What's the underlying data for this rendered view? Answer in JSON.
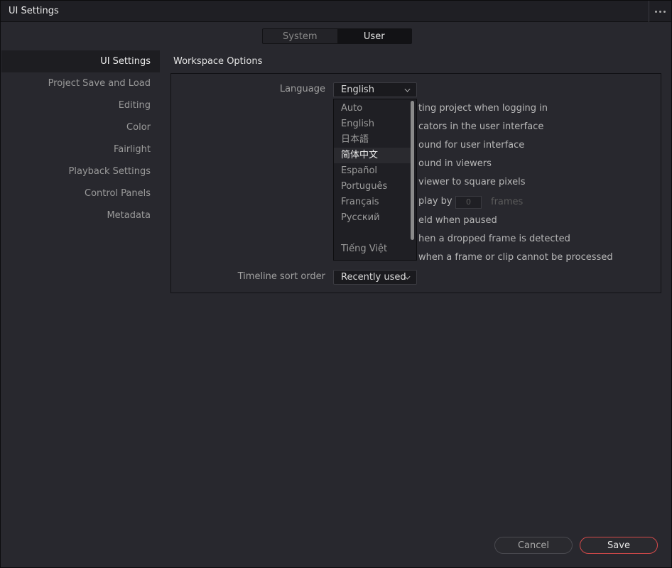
{
  "window": {
    "title": "UI Settings"
  },
  "tabs": [
    {
      "label": "System",
      "active": false
    },
    {
      "label": "User",
      "active": true
    }
  ],
  "sidebar": {
    "items": [
      {
        "label": "UI Settings",
        "active": true
      },
      {
        "label": "Project Save and Load",
        "active": false
      },
      {
        "label": "Editing",
        "active": false
      },
      {
        "label": "Color",
        "active": false
      },
      {
        "label": "Fairlight",
        "active": false
      },
      {
        "label": "Playback Settings",
        "active": false
      },
      {
        "label": "Control Panels",
        "active": false
      },
      {
        "label": "Metadata",
        "active": false
      }
    ]
  },
  "workspace": {
    "title": "Workspace Options",
    "language_label": "Language",
    "language_value": "English",
    "options": [
      "ting project when logging in",
      "cators in the user interface",
      "ound for user interface",
      "ound in viewers",
      "viewer to square pixels",
      "play by",
      "eld when paused",
      "hen a dropped frame is detected",
      "when a frame or clip cannot be processed"
    ],
    "delay_value": "0",
    "delay_unit": "frames",
    "timeline_label": "Timeline sort order",
    "timeline_value": "Recently used"
  },
  "language_dropdown": {
    "options": [
      "Auto",
      "English",
      "日本語",
      "简体中文",
      "Español",
      "Português",
      "Français",
      "Русский",
      "",
      "Tiếng Việt"
    ],
    "highlighted": "简体中文"
  },
  "footer": {
    "cancel_label": "Cancel",
    "save_label": "Save"
  },
  "colors": {
    "accent_save_border": "#d44a4a",
    "background": "#28282e"
  }
}
